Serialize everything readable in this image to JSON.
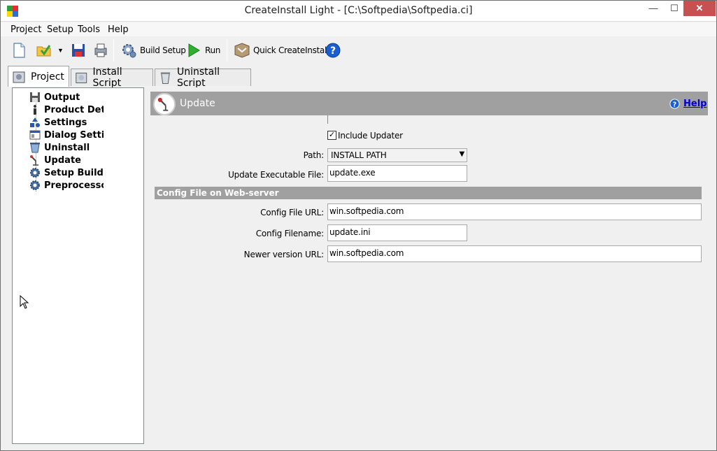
{
  "window": {
    "title": "CreateInstall Light - [C:\\Softpedia\\Softpedia.ci]",
    "min_icon": "minimize-icon",
    "max_icon": "maximize-icon",
    "close_icon": "close-icon"
  },
  "menu": {
    "items": [
      {
        "label": "Project"
      },
      {
        "label": "Setup"
      },
      {
        "label": "Tools"
      },
      {
        "label": "Help"
      }
    ]
  },
  "toolbar": {
    "build_setup_label": "Build Setup",
    "run_label": "Run",
    "quick_label": "Quick CreateInstall"
  },
  "tabs": [
    {
      "label": "Project",
      "active": true
    },
    {
      "label": "Install Script",
      "active": false
    },
    {
      "label": "Uninstall Script",
      "active": false
    }
  ],
  "tree": {
    "items": [
      {
        "label": "Output",
        "icon": "floppy-icon"
      },
      {
        "label": "Product Details",
        "icon": "info-icon"
      },
      {
        "label": "Settings",
        "icon": "shapes-icon"
      },
      {
        "label": "Dialog Settings",
        "icon": "dialog-icon"
      },
      {
        "label": "Uninstall",
        "icon": "uninstall-icon"
      },
      {
        "label": "Update",
        "icon": "antenna-icon"
      },
      {
        "label": "Setup Builder",
        "icon": "gear-icon"
      },
      {
        "label": "Preprocessor",
        "icon": "gear-icon"
      }
    ]
  },
  "section": {
    "title": "Update",
    "help_label": "Help"
  },
  "form": {
    "include_updater_label": "Include Updater",
    "include_updater_checked": true,
    "path_label": "Path:",
    "path_value": "INSTALL PATH",
    "update_exe_label": "Update Executable File:",
    "update_exe_value": "update.exe"
  },
  "config": {
    "title": "Config File on Web-server",
    "url_label": "Config File URL:",
    "url_value": "win.softpedia.com",
    "filename_label": "Config Filename:",
    "filename_value": "update.ini",
    "newer_label": "Newer version URL:",
    "newer_value": "win.softpedia.com"
  },
  "colors": {
    "header_gray": "#a0a0a0",
    "link_blue": "#0000cc",
    "close_red": "#c75050"
  }
}
